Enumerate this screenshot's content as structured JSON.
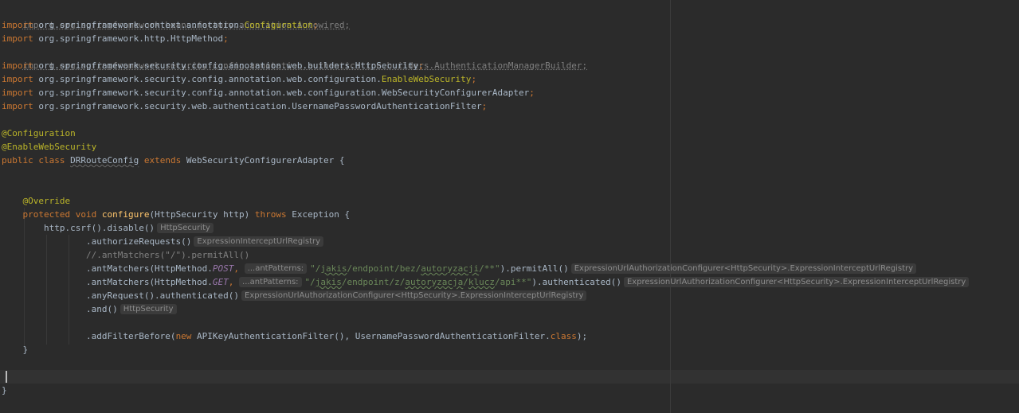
{
  "code": {
    "imports": [
      {
        "keyword": "import",
        "path": "org.springframework.beans.factory.annotation.Autowired;",
        "unused": true
      },
      {
        "keyword": "import",
        "path": "org.springframework.context.annotation.",
        "highlight": "Configuration",
        "suffix": ";"
      },
      {
        "keyword": "import",
        "path": "org.springframework.http.HttpMethod",
        "suffix": ";"
      },
      {
        "keyword": "import",
        "path": "org.springframework.security.config.annotation.authentication.builders.AuthenticationManagerBuilder;",
        "unused": true
      },
      {
        "keyword": "import",
        "path": "org.springframework.security.config.annotation.web.builders.HttpSecurity",
        "suffix": ";"
      },
      {
        "keyword": "import",
        "path": "org.springframework.security.config.annotation.web.configuration.",
        "highlight": "EnableWebSecurity",
        "suffix": ";"
      },
      {
        "keyword": "import",
        "path": "org.springframework.security.config.annotation.web.configuration.WebSecurityConfigurerAdapter",
        "suffix": ";"
      },
      {
        "keyword": "import",
        "path": "org.springframework.security.web.authentication.UsernamePasswordAuthenticationFilter",
        "suffix": ";"
      }
    ],
    "annotations": [
      "@Configuration",
      "@EnableWebSecurity"
    ],
    "class_decl": {
      "modifiers": "public class",
      "name": "DRRouteConfig",
      "extends_kw": "extends",
      "parent": "WebSecurityConfigurerAdapter",
      "brace": "{"
    },
    "method": {
      "annotation": "@Override",
      "modifiers": "protected void",
      "name": "configure",
      "params": "(HttpSecurity http)",
      "throws_kw": "throws",
      "exception": "Exception {",
      "close_brace": "}"
    },
    "body": {
      "csrf_call": "http.csrf().disable()",
      "csrf_hint": "HttpSecurity",
      "authorize_call": ".authorizeRequests()",
      "authorize_hint": "ExpressionInterceptUrlRegistry",
      "comment": "//.antMatchers(\"/\").permitAll()",
      "post_prefix": ".antMatchers(HttpMethod.",
      "post_const": "POST",
      "post_param_hint": "...antPatterns:",
      "post_str_a": "\"/",
      "post_str_b": "jakis",
      "post_str_c": "/endpoint/bez/",
      "post_str_d": "autoryzacji",
      "post_str_e": "/**\"",
      "post_suffix": ").permitAll()",
      "post_hint": "ExpressionUrlAuthorizationConfigurer<HttpSecurity>.ExpressionInterceptUrlRegistry",
      "get_prefix": ".antMatchers(HttpMethod.",
      "get_const": "GET",
      "get_param_hint": "...antPatterns:",
      "get_str_a": "\"/",
      "get_str_b": "jakis",
      "get_str_c": "/endpoint/z/",
      "get_str_d": "autoryzacja",
      "get_str_e": "/",
      "get_str_f": "klucz",
      "get_str_g": "/api**\"",
      "get_suffix": ").authenticated()",
      "get_hint": "ExpressionUrlAuthorizationConfigurer<HttpSecurity>.ExpressionInterceptUrlRegistry",
      "any_call": ".anyRequest().authenticated()",
      "any_hint": "ExpressionUrlAuthorizationConfigurer<HttpSecurity>.ExpressionInterceptUrlRegistry",
      "and_call": ".and()",
      "and_hint": "HttpSecurity",
      "filter_a": ".addFilterBefore(",
      "filter_new": "new",
      "filter_b": " APIKeyAuthenticationFilter(), UsernamePasswordAuthenticationFilter.",
      "filter_class": "class",
      "filter_c": ");"
    },
    "class_close": "}"
  },
  "colors": {
    "background": "#2b2b2b",
    "keyword": "#cc7832",
    "annotation": "#bbb529",
    "string": "#6a8759",
    "text": "#a9b7c6",
    "comment": "#808080",
    "hint_bg": "#3b3b3b"
  }
}
